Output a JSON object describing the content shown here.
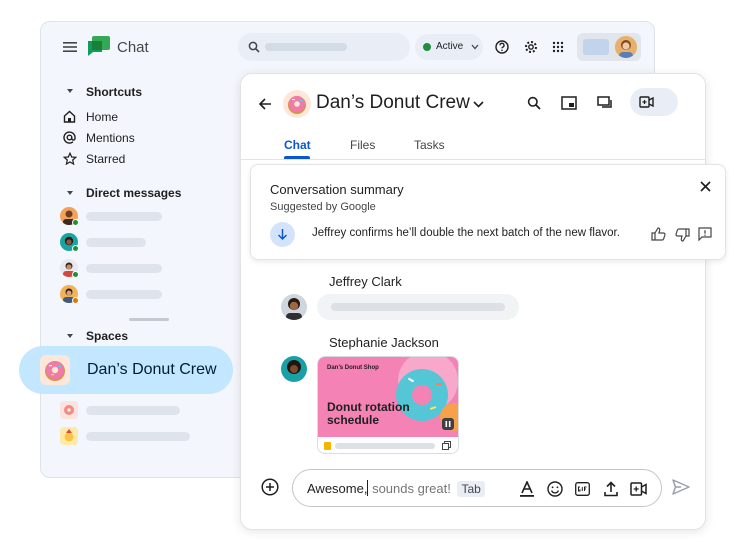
{
  "app": {
    "name": "Chat"
  },
  "status": {
    "label": "Active",
    "color": "#1e8e3e"
  },
  "sidebar": {
    "shortcuts_heading": "Shortcuts",
    "shortcuts": [
      {
        "label": "Home",
        "icon": "home-icon"
      },
      {
        "label": "Mentions",
        "icon": "at-icon"
      },
      {
        "label": "Starred",
        "icon": "star-icon"
      }
    ],
    "dm_heading": "Direct messages",
    "spaces_heading": "Spaces",
    "selected_space": {
      "label": "Dan’s Donut Crew",
      "icon": "donut-icon"
    }
  },
  "space": {
    "title": "Dan’s Donut Crew",
    "tabs": [
      {
        "label": "Chat",
        "active": true
      },
      {
        "label": "Files",
        "active": false
      },
      {
        "label": "Tasks",
        "active": false
      }
    ]
  },
  "summary": {
    "title": "Conversation summary",
    "subtitle": "Suggested by Google",
    "text": "Jeffrey confirms he’ll double the next batch of the new flavor."
  },
  "messages": [
    {
      "sender": "Jeffrey Clark"
    },
    {
      "sender": "Stephanie Jackson",
      "card": {
        "kicker": "Dan’s Donut Shop",
        "headline": "Donut rotation schedule"
      }
    }
  ],
  "composer": {
    "typed": "Awesome,",
    "suggestion": " sounds great!",
    "tab_hint": "Tab"
  },
  "colors": {
    "accent": "#0b57d0",
    "selected_bg": "#c2e7ff",
    "chat_green": "#1ea362"
  }
}
